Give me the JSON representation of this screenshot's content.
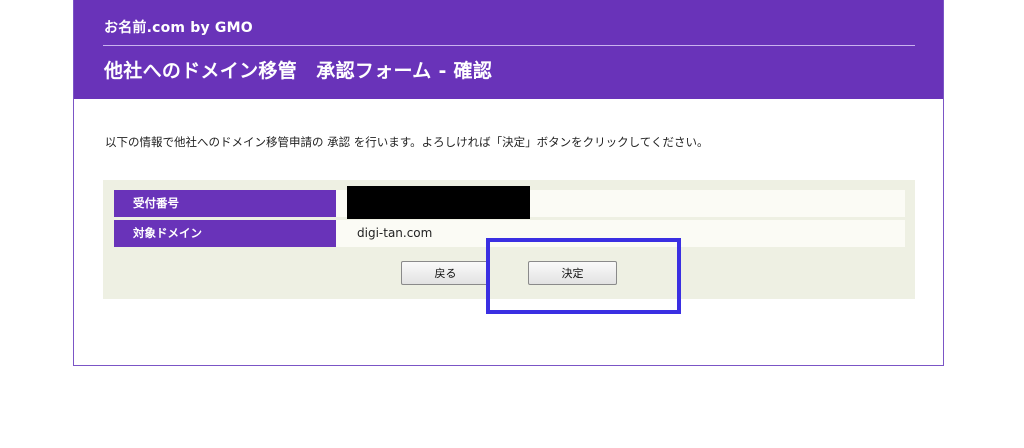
{
  "header": {
    "brand": "お名前.com by GMO",
    "title": "他社へのドメイン移管　承認フォーム - 確認"
  },
  "instruction": "以下の情報で他社へのドメイン移管申請の 承認 を行います。よろしければ「決定」ボタンをクリックしてください。",
  "form": {
    "rows": [
      {
        "label": "受付番号",
        "value": "",
        "redacted": true
      },
      {
        "label": "対象ドメイン",
        "value": "digi-tan.com"
      }
    ]
  },
  "buttons": {
    "back": "戻る",
    "decide": "決定"
  },
  "colors": {
    "header_bg": "#6933b9",
    "panel_bg": "#eef0e3",
    "highlight": "#3a2fe2"
  }
}
